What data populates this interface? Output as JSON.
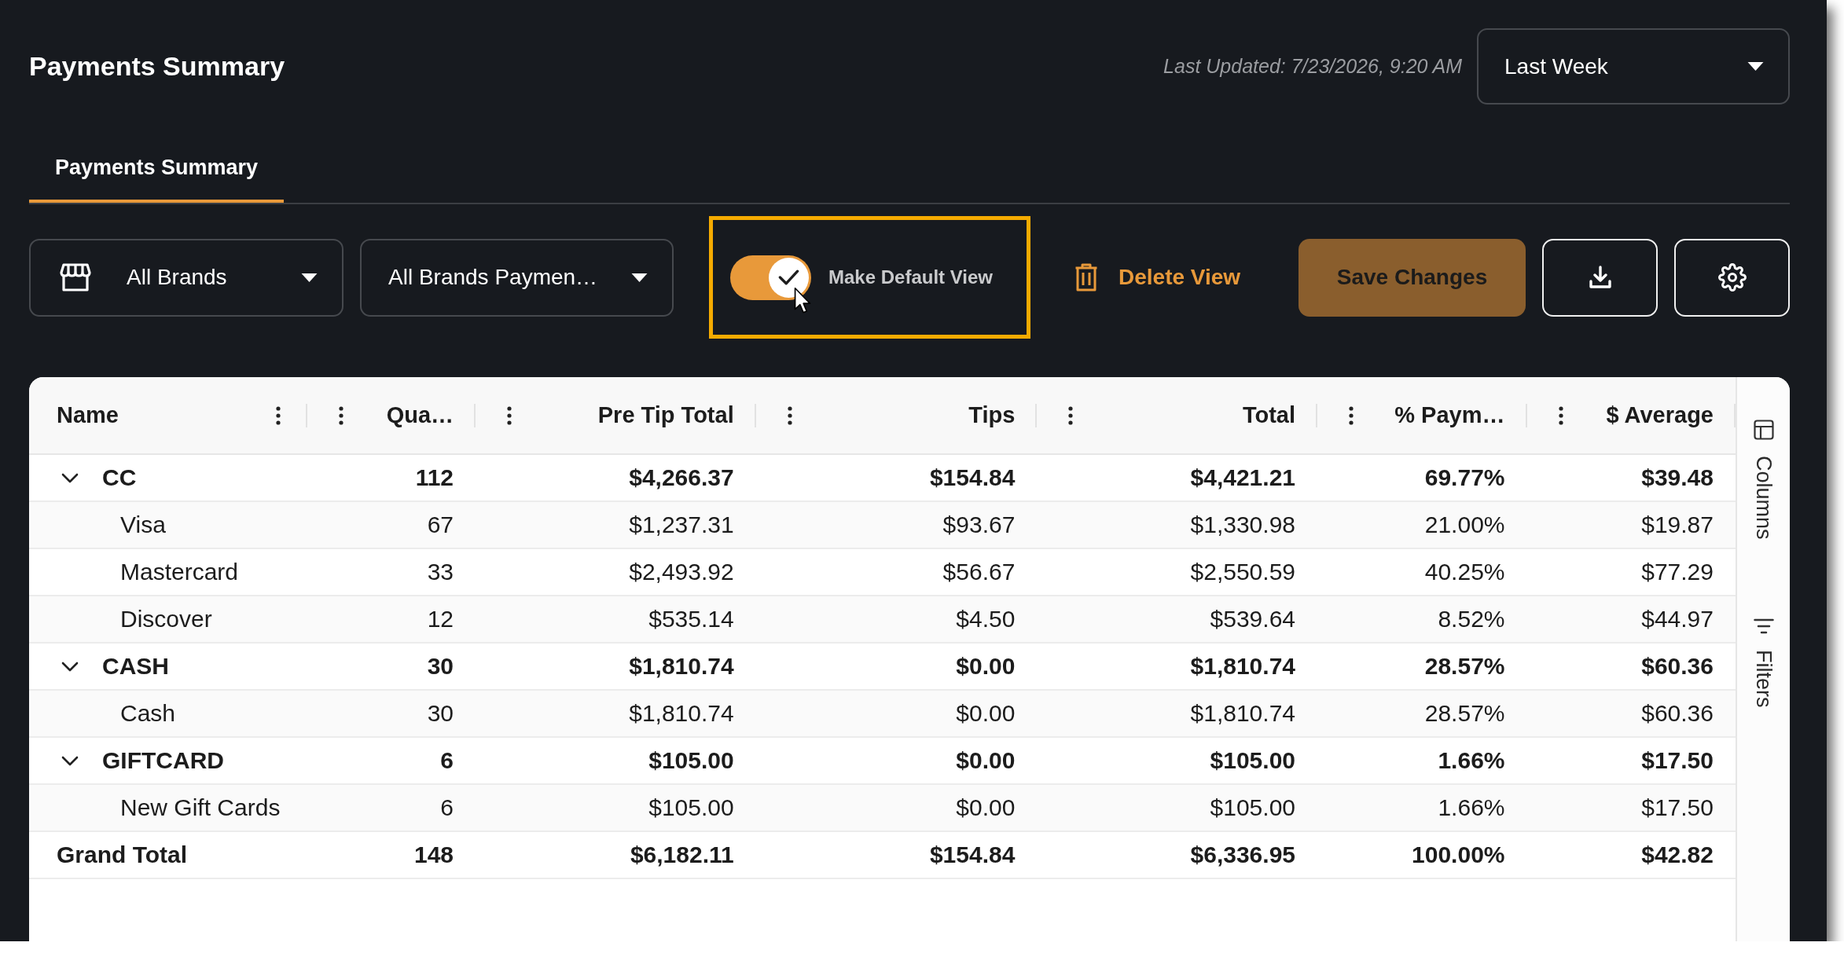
{
  "header": {
    "title": "Payments Summary",
    "last_updated": "Last Updated: 7/23/2026, 9:20 AM",
    "date_range": "Last Week"
  },
  "tabs": [
    {
      "label": "Payments Summary",
      "selected": true
    }
  ],
  "toolbar": {
    "brand_filter": "All Brands",
    "view_select": "All Brands Paymen…",
    "default_view": {
      "label": "Make Default View",
      "on": true,
      "highlighted": true
    },
    "delete_button": "Delete View",
    "save_button": "Save Changes"
  },
  "table": {
    "columns": [
      {
        "label": "Name",
        "kind": "text"
      },
      {
        "label": "Qua…",
        "kind": "number"
      },
      {
        "label": "Pre Tip Total",
        "kind": "number"
      },
      {
        "label": "Tips",
        "kind": "number"
      },
      {
        "label": "Total",
        "kind": "number"
      },
      {
        "label": "% Paym…",
        "kind": "number"
      },
      {
        "label": "$ Average",
        "kind": "number"
      }
    ],
    "groups": [
      {
        "name": "CC",
        "expanded": true,
        "cells": [
          "112",
          "$4,266.37",
          "$154.84",
          "$4,421.21",
          "69.77%",
          "$39.48"
        ],
        "children": [
          {
            "name": "Visa",
            "cells": [
              "67",
              "$1,237.31",
              "$93.67",
              "$1,330.98",
              "21.00%",
              "$19.87"
            ]
          },
          {
            "name": "Mastercard",
            "cells": [
              "33",
              "$2,493.92",
              "$56.67",
              "$2,550.59",
              "40.25%",
              "$77.29"
            ]
          },
          {
            "name": "Discover",
            "cells": [
              "12",
              "$535.14",
              "$4.50",
              "$539.64",
              "8.52%",
              "$44.97"
            ]
          }
        ]
      },
      {
        "name": "CASH",
        "expanded": true,
        "cells": [
          "30",
          "$1,810.74",
          "$0.00",
          "$1,810.74",
          "28.57%",
          "$60.36"
        ],
        "children": [
          {
            "name": "Cash",
            "cells": [
              "30",
              "$1,810.74",
              "$0.00",
              "$1,810.74",
              "28.57%",
              "$60.36"
            ]
          }
        ]
      },
      {
        "name": "GIFTCARD",
        "expanded": true,
        "cells": [
          "6",
          "$105.00",
          "$0.00",
          "$105.00",
          "1.66%",
          "$17.50"
        ],
        "children": [
          {
            "name": "New Gift Cards",
            "cells": [
              "6",
              "$105.00",
              "$0.00",
              "$105.00",
              "1.66%",
              "$17.50"
            ]
          }
        ]
      }
    ],
    "grand_total": {
      "name": "Grand Total",
      "cells": [
        "148",
        "$6,182.11",
        "$154.84",
        "$6,336.95",
        "100.00%",
        "$42.82"
      ]
    }
  },
  "side_panel": {
    "tabs": [
      {
        "label": "Columns",
        "kind": "columns",
        "selected": false
      },
      {
        "label": "Filters",
        "kind": "filters",
        "selected": false
      }
    ]
  }
}
